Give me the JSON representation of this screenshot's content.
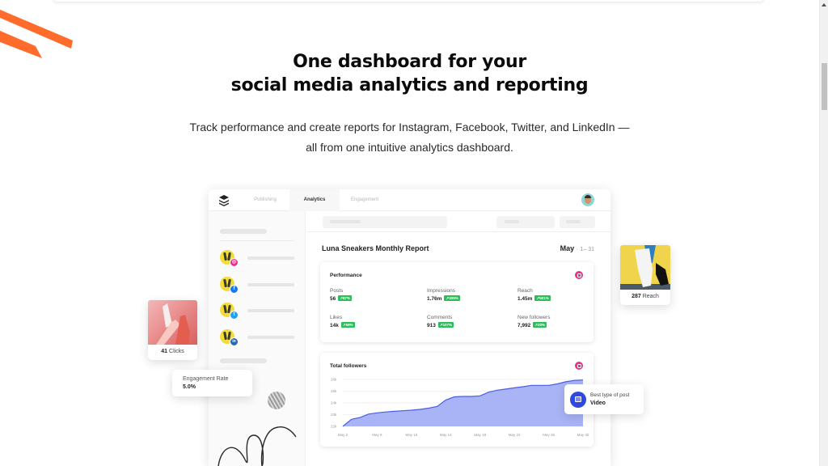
{
  "hero": {
    "title_line1": "One dashboard for your",
    "title_line2": "social media analytics and reporting",
    "subtitle_line1": "Track performance and create reports for Instagram, Facebook, Twitter, and LinkedIn —",
    "subtitle_line2": "all from one intuitive analytics dashboard."
  },
  "colors": {
    "accent_orange": "#ff6b2b",
    "chart_line": "#4a5ce8",
    "chart_fill": "#a4b0f5",
    "badge_green": "#2bbf5a",
    "instagram": "#e8338a",
    "facebook": "#1877f2",
    "twitter": "#1da1f2",
    "linkedin": "#2867b2",
    "video_icon": "#2f48e0"
  },
  "dashboard": {
    "nav": {
      "logo": "buffer-stack-icon",
      "tabs": [
        {
          "label": "Publishing",
          "active": false
        },
        {
          "label": "Analytics",
          "active": true
        },
        {
          "label": "Engagement",
          "active": false
        }
      ],
      "avatar": "user-avatar"
    },
    "sidebar": {
      "accounts": [
        {
          "network": "instagram",
          "icon": "instagram-icon",
          "glyph": "◎"
        },
        {
          "network": "facebook",
          "icon": "facebook-icon",
          "glyph": "f"
        },
        {
          "network": "twitter",
          "icon": "twitter-icon",
          "glyph": "t"
        },
        {
          "network": "linkedin",
          "icon": "linkedin-icon",
          "glyph": "in"
        }
      ]
    },
    "report": {
      "title": "Luna Sneakers Monthly Report",
      "month": "May",
      "separator": "·",
      "range": "1– 31"
    },
    "performance": {
      "title": "Performance",
      "metrics": [
        {
          "label": "Posts",
          "value": "56",
          "change": "↗87%"
        },
        {
          "label": "Impressions",
          "value": "1.76m",
          "change": "↗305%"
        },
        {
          "label": "Reach",
          "value": "1.45m",
          "change": "↗501%"
        },
        {
          "label": "Likes",
          "value": "14k",
          "change": "↗58%"
        },
        {
          "label": "Comments",
          "value": "913",
          "change": "↗107%"
        },
        {
          "label": "New followers",
          "value": "7,992",
          "change": "↗20%"
        }
      ]
    },
    "followers": {
      "title": "Total followers"
    }
  },
  "chart_data": {
    "type": "area",
    "title": "Total followers",
    "xlabel": "",
    "ylabel": "",
    "x": [
      2,
      3,
      4,
      5,
      6,
      7,
      8,
      9,
      10,
      11,
      12,
      13,
      14,
      15,
      16,
      17,
      18,
      19,
      20,
      21,
      22,
      23,
      24,
      25,
      26,
      27,
      28,
      29,
      30
    ],
    "x_tick_labels": [
      "May 2",
      "May 6",
      "May 10",
      "May 14",
      "May 18",
      "May 22",
      "May 26",
      "May 30"
    ],
    "x_tick_values": [
      2,
      6,
      10,
      14,
      18,
      22,
      26,
      30
    ],
    "y_tick_labels": [
      "22k",
      "23k",
      "24k",
      "25k",
      "26k"
    ],
    "y_tick_values": [
      22000,
      23000,
      24000,
      25000,
      26000
    ],
    "ylim": [
      22000,
      26000
    ],
    "grid": true,
    "series": [
      {
        "name": "Total followers",
        "values": [
          22000,
          22600,
          22750,
          23050,
          23150,
          23230,
          23280,
          23330,
          23380,
          23450,
          23550,
          23700,
          24250,
          24520,
          24550,
          24550,
          24600,
          24920,
          25080,
          25180,
          25280,
          25380,
          25500,
          25500,
          25500,
          25620,
          25800,
          25920,
          25950
        ]
      }
    ]
  },
  "floating_cards": {
    "clicks": {
      "value": "41",
      "label": "Clicks"
    },
    "engagement": {
      "label": "Engagement Rate",
      "value": "5.0%"
    },
    "reach": {
      "value": "287",
      "label": "Reach"
    },
    "best_post": {
      "label": "Best type of post",
      "value": "Video",
      "icon": "video-icon"
    }
  }
}
